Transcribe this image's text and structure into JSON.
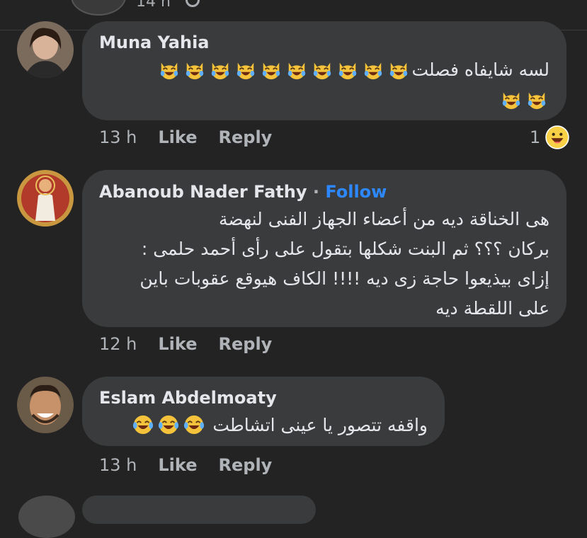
{
  "top": {
    "time_fragment": "14 h"
  },
  "comments": [
    {
      "author": "Muna Yahia",
      "text_line1": "لسه شايفاه فصلت",
      "time": "13 h",
      "like_label": "Like",
      "reply_label": "Reply",
      "reaction_count": "1",
      "emoji": "crying-laughing-cat",
      "emoji_count_line1": 10,
      "emoji_count_line2": 2
    },
    {
      "author": "Abanoub Nader Fathy",
      "separator": "·",
      "follow_label": "Follow",
      "lines": [
        "هى الخناقة ديه من أعضاء الجهاز الفنى لنهضة",
        "بركان ؟؟؟ ثم البنت شكلها بتقول على رأى أحمد حلمى :",
        "إزاى بيذيعوا حاجة زى ديه !!!! الكاف هيوقع عقوبات باين",
        "على اللقطة ديه"
      ],
      "time": "12 h",
      "like_label": "Like",
      "reply_label": "Reply"
    },
    {
      "author": "Eslam Abdelmoaty",
      "text": "واقفه تتصور يا عينى اتشاطت",
      "emoji": "tears-of-joy",
      "emoji_count": 3,
      "time": "13 h",
      "like_label": "Like",
      "reply_label": "Reply"
    }
  ],
  "colors": {
    "background": "#232323",
    "bubble": "#3a3b3c",
    "text": "#e4e6eb",
    "meta": "#b0b3b8",
    "follow": "#2d88ff"
  }
}
